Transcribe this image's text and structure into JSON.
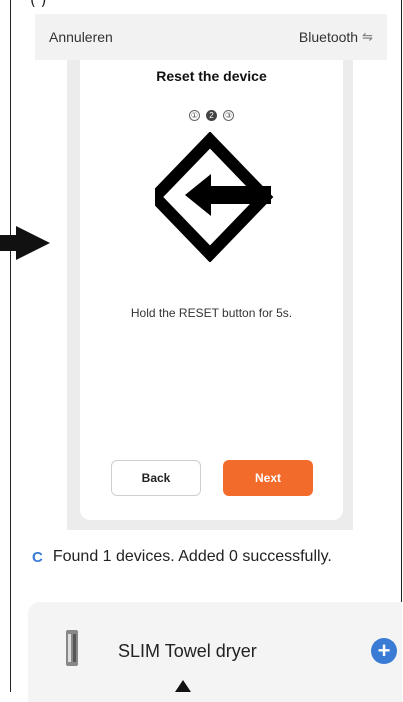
{
  "caption": "(                                                        )",
  "header": {
    "cancel_label": "Annuleren",
    "bluetooth_label": "Bluetooth",
    "bluetooth_icon": "⇋"
  },
  "dialog": {
    "title": "Reset the device",
    "steps": [
      "①",
      "2",
      "③"
    ],
    "active_step": 2,
    "instruction": "Hold the RESET button for 5s.",
    "back_label": "Back",
    "next_label": "Next"
  },
  "status": {
    "found_text": "Found 1 devices. Added 0 successfully."
  },
  "device": {
    "name": "SLIM Towel dryer"
  },
  "colors": {
    "accent": "#f26b2a",
    "blue": "#3a7bd5"
  }
}
